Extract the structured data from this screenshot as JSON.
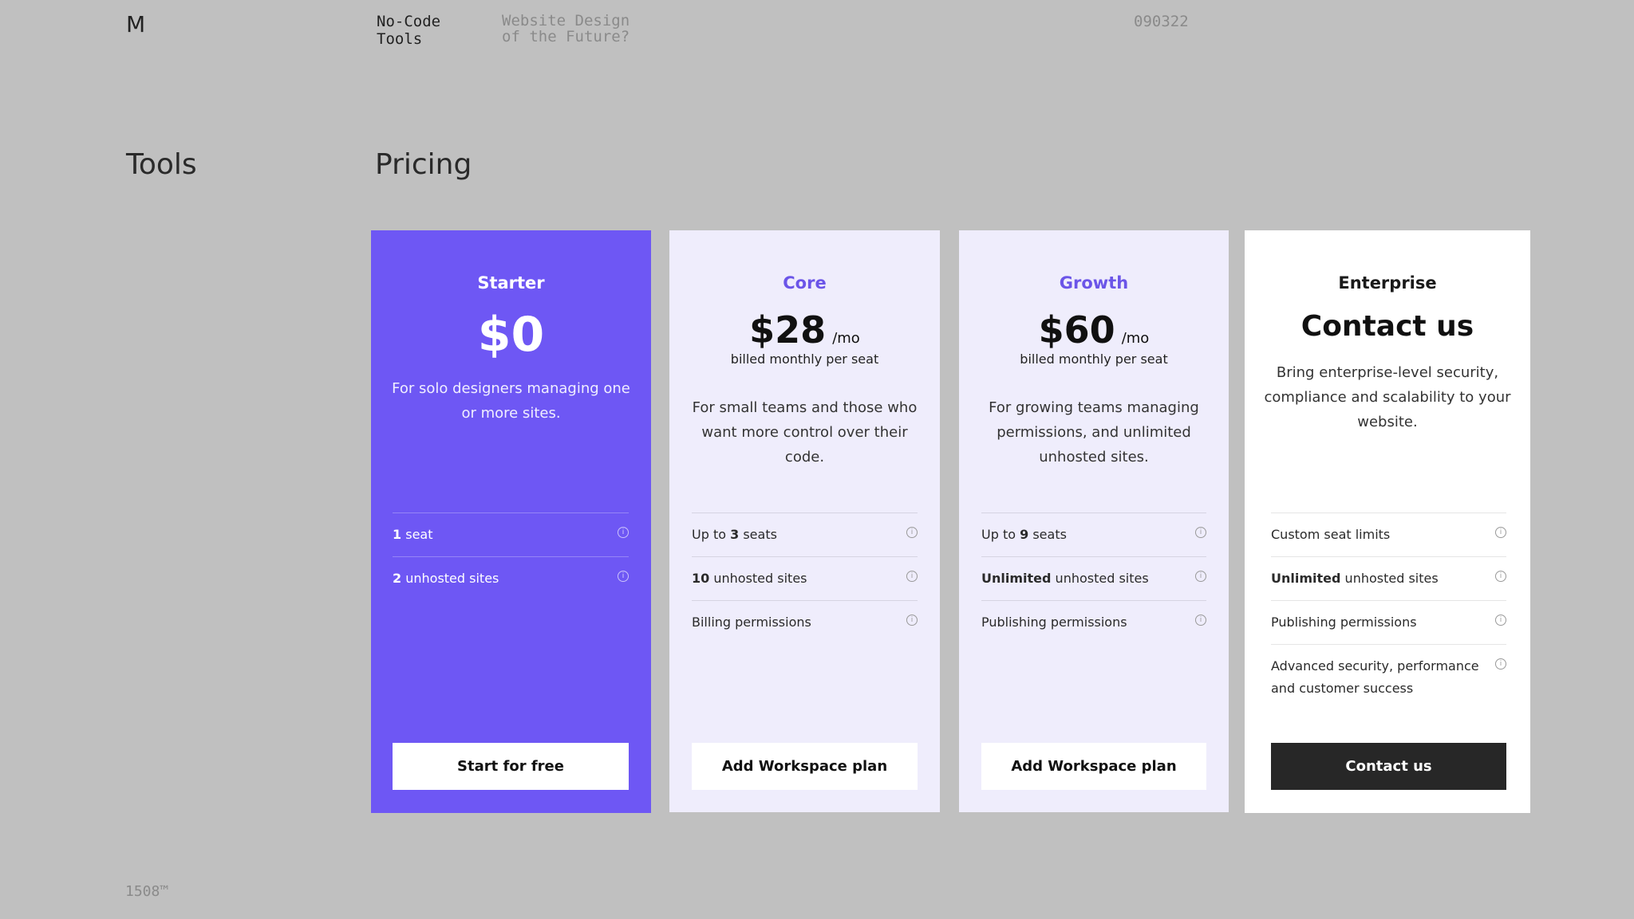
{
  "header": {
    "logo": "M",
    "nav_item_1": "No-Code Tools",
    "nav_item_2": "Website Design of the Future?",
    "code": "090322"
  },
  "sections": {
    "left_title": "Tools",
    "main_title": "Pricing"
  },
  "colors": {
    "accent": "#6e57f4",
    "card_tint": "#efedfc",
    "dark_button": "#272727",
    "background": "#c0c0c0"
  },
  "plans": [
    {
      "name": "Starter",
      "price": "$0",
      "period": "",
      "billing": "",
      "description": "For solo designers managing one or more sites.",
      "features": [
        {
          "strong": "1",
          "text": " seat",
          "icon": "info-icon"
        },
        {
          "strong": "2",
          "text": " unhosted sites",
          "icon": "info-icon"
        }
      ],
      "button": "Start for free"
    },
    {
      "name": "Core",
      "price": "$28",
      "period": "/mo",
      "billing": "billed monthly per seat",
      "description": "For small teams and those who want more control over their code.",
      "features": [
        {
          "pre": "Up to ",
          "strong": "3",
          "text": " seats",
          "icon": "info-icon"
        },
        {
          "strong": "10",
          "text": " unhosted sites",
          "icon": "info-icon"
        },
        {
          "text": "Billing permissions",
          "icon": "info-icon"
        }
      ],
      "button": "Add Workspace plan"
    },
    {
      "name": "Growth",
      "price": "$60",
      "period": "/mo",
      "billing": "billed monthly per seat",
      "description": "For growing teams managing permissions, and unlimited unhosted sites.",
      "features": [
        {
          "pre": "Up to ",
          "strong": "9",
          "text": " seats",
          "icon": "info-icon"
        },
        {
          "strong": "Unlimited",
          "text": " unhosted sites",
          "icon": "info-icon"
        },
        {
          "text": "Publishing permissions",
          "icon": "info-icon"
        }
      ],
      "button": "Add Workspace plan"
    },
    {
      "name": "Enterprise",
      "price": "Contact us",
      "period": "",
      "billing": "",
      "description": "Bring enterprise-level security, compliance and scalability to your website.",
      "features": [
        {
          "text": "Custom seat limits",
          "icon": "info-icon"
        },
        {
          "strong": "Unlimited",
          "text": " unhosted sites",
          "icon": "info-icon"
        },
        {
          "text": "Publishing permissions",
          "icon": "info-icon"
        },
        {
          "text": "Advanced security, performance and customer success",
          "icon": "info-icon"
        }
      ],
      "button": "Contact us"
    }
  ],
  "footer": {
    "label": "1508™"
  }
}
